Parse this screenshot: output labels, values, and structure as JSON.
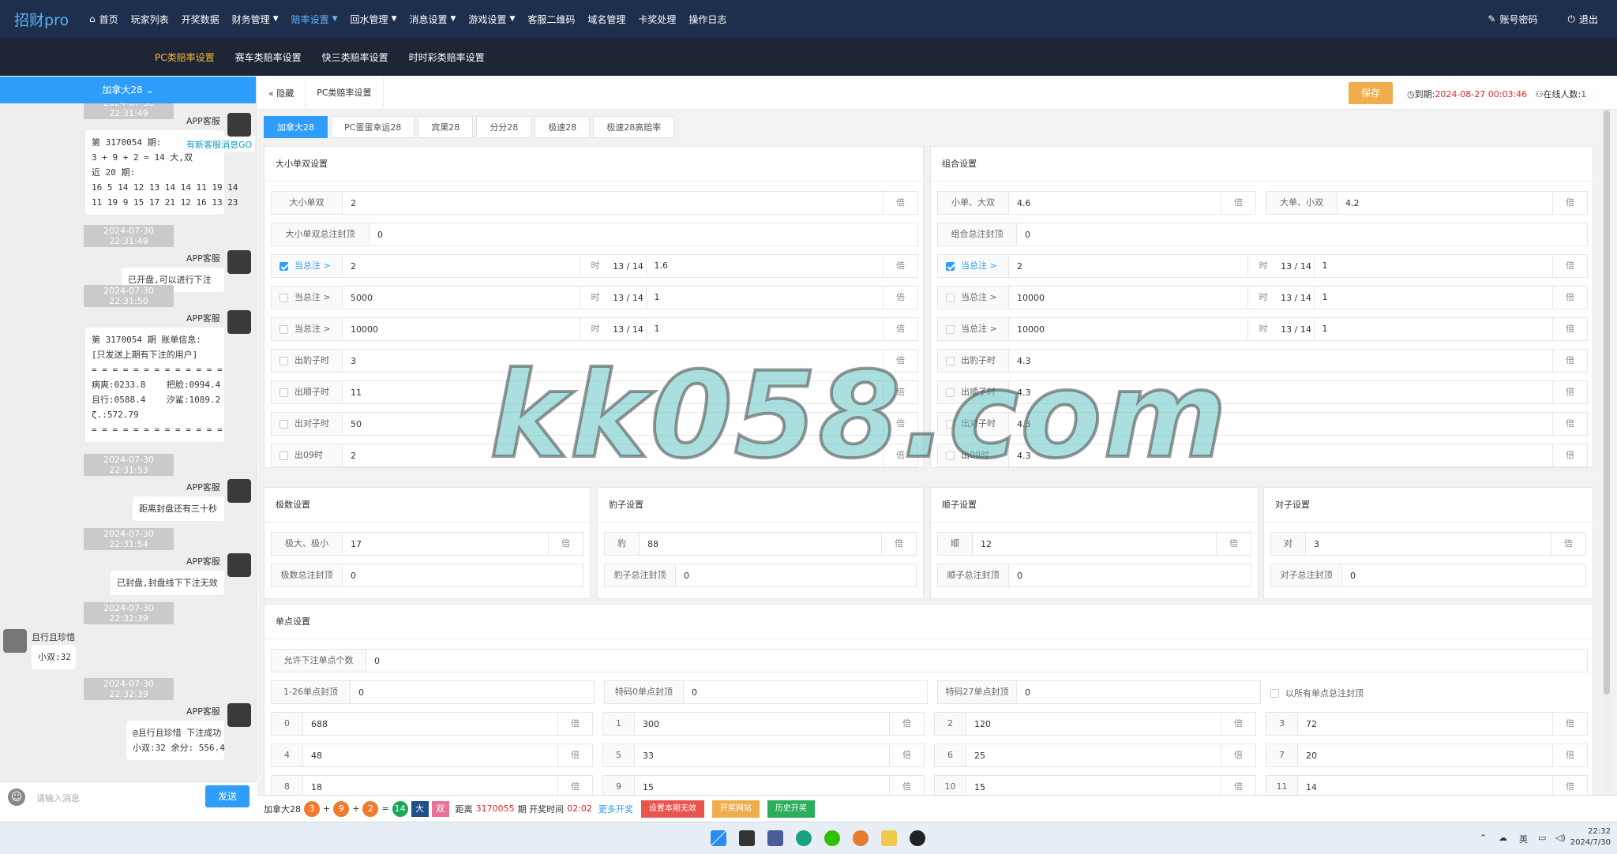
{
  "nav": {
    "logo": "招财pro",
    "home": "首页",
    "items": [
      {
        "label": "玩家列表",
        "dropdown": false
      },
      {
        "label": "开奖数据",
        "dropdown": false
      },
      {
        "label": "财务管理",
        "dropdown": true
      },
      {
        "label": "赔率设置",
        "dropdown": true,
        "active": true
      },
      {
        "label": "回水管理",
        "dropdown": true
      },
      {
        "label": "消息设置",
        "dropdown": true
      },
      {
        "label": "游戏设置",
        "dropdown": true
      },
      {
        "label": "客服二维码",
        "dropdown": false
      },
      {
        "label": "域名管理",
        "dropdown": false
      },
      {
        "label": "卡奖处理",
        "dropdown": false
      },
      {
        "label": "操作日志",
        "dropdown": false
      }
    ],
    "account": "账号密码",
    "logout": "退出"
  },
  "subnav": [
    "PC类赔率设置",
    "赛车类赔率设置",
    "快三类赔率设置",
    "时时彩类赔率设置"
  ],
  "chat": {
    "header": "加拿大28",
    "new_msg": "有新客服消息GO",
    "input_placeholder": "请输入消息",
    "send": "发送",
    "top_ts": "2024-07-30 22:31:49",
    "messages": [
      {
        "ts": "",
        "sender": "APP客服",
        "text": "第 3170054 期:\n3 + 9 + 2 = 14 大,双\n近 20 期:\n16 5 14 12 13 14 14 11 19 14\n11 19 9 15 17 21 12 16 13 23"
      },
      {
        "ts": "2024-07-30 22:31:49",
        "sender": "APP客服",
        "text": "已开盘,可以进行下注"
      },
      {
        "ts": "2024-07-30 22:31:50",
        "sender": "APP客服",
        "text": "第 3170054 期 账单信息:\n[只发送上期有下注的用户]\n= = = = = = = = = = = = =\n病爽:0233.8    把脸:0994.4\n且行:0588.4    汐鲨:1089.2\nζ.:572.79\n= = = = = = = = = = = = ="
      },
      {
        "ts": "2024-07-30 22:31:53",
        "sender": "APP客服",
        "text": "距离封盘还有三十秒"
      },
      {
        "ts": "2024-07-30 22:31:54",
        "sender": "APP客服",
        "text": "已封盘,封盘线下下注无效"
      },
      {
        "ts": "2024-07-30 22:32:39",
        "sender": "且行且珍惜",
        "text": "小双:32"
      },
      {
        "ts": "2024-07-30 22:32:39",
        "sender": "APP客服",
        "text": "@且行且珍惜 下注成功\n小双:32 余分: 556.4"
      }
    ]
  },
  "toolbar": {
    "hide": "隐藏",
    "tab": "PC类赔率设置",
    "save": "保存",
    "expire_label": "到期:",
    "expire_value": "2024-08-27 00:03:46",
    "online_label": "在线人数:",
    "online_value": "1"
  },
  "game_tabs": [
    "加拿大28",
    "PC蛋蛋幸运28",
    "宾果28",
    "分分28",
    "极速28",
    "极速28高赔率"
  ],
  "common": {
    "unit": "倍",
    "when": "时",
    "ratio": "13 / 14"
  },
  "dxds": {
    "title": "大小单双设置",
    "odds_label": "大小单双",
    "odds": "2",
    "cap_label": "大小单双总注封顶",
    "cap": "0",
    "thresholds": [
      {
        "checked": true,
        "label": "当总注 >",
        "amount": "2",
        "rate": "1.6"
      },
      {
        "checked": false,
        "label": "当总注 >",
        "amount": "5000",
        "rate": "1"
      },
      {
        "checked": false,
        "label": "当总注 >",
        "amount": "10000",
        "rate": "1"
      }
    ],
    "specials": [
      {
        "label": "出豹子时",
        "value": "3"
      },
      {
        "label": "出顺子时",
        "value": "11"
      },
      {
        "label": "出对子时",
        "value": "50"
      },
      {
        "label": "出09时",
        "value": "2"
      }
    ]
  },
  "combo": {
    "title": "组合设置",
    "a_label": "小单、大双",
    "a": "4.6",
    "b_label": "大单、小双",
    "b": "4.2",
    "cap_label": "组合总注封顶",
    "cap": "0",
    "thresholds": [
      {
        "checked": true,
        "label": "当总注 >",
        "amount": "2",
        "rate": "1"
      },
      {
        "checked": false,
        "label": "当总注 >",
        "amount": "10000",
        "rate": "1"
      },
      {
        "checked": false,
        "label": "当总注 >",
        "amount": "10000",
        "rate": "1"
      }
    ],
    "specials": [
      {
        "label": "出豹子时",
        "value": "4.3"
      },
      {
        "label": "出顺子时",
        "value": "4.3"
      },
      {
        "label": "出对子时",
        "value": "4.3"
      },
      {
        "label": "出09时",
        "value": "4.3"
      }
    ]
  },
  "jishu": {
    "title": "极数设置",
    "label": "极大、极小",
    "value": "17",
    "cap_label": "极数总注封顶",
    "cap": "0"
  },
  "baozi": {
    "title": "豹子设置",
    "label": "豹",
    "value": "88",
    "cap_label": "豹子总注封顶",
    "cap": "0"
  },
  "shunzi": {
    "title": "顺子设置",
    "label": "顺",
    "value": "12",
    "cap_label": "顺子总注封顶",
    "cap": "0"
  },
  "duizi": {
    "title": "对子设置",
    "label": "对",
    "value": "3",
    "cap_label": "对子总注封顶",
    "cap": "0"
  },
  "danian": {
    "title": "单点设置",
    "allow_label": "允许下注单点个数",
    "allow": "0",
    "caps": [
      {
        "label": "1-26单点封顶",
        "value": "0"
      },
      {
        "label": "特码0单点封顶",
        "value": "0"
      },
      {
        "label": "特码27单点封顶",
        "value": "0"
      }
    ],
    "all_cap": "以所有单点总注封顶",
    "points": [
      {
        "n": "0",
        "v": "688"
      },
      {
        "n": "1",
        "v": "300"
      },
      {
        "n": "2",
        "v": "120"
      },
      {
        "n": "3",
        "v": "72"
      },
      {
        "n": "4",
        "v": "48"
      },
      {
        "n": "5",
        "v": "33"
      },
      {
        "n": "6",
        "v": "25"
      },
      {
        "n": "7",
        "v": "20"
      },
      {
        "n": "8",
        "v": "18"
      },
      {
        "n": "9",
        "v": "15"
      },
      {
        "n": "10",
        "v": "15"
      },
      {
        "n": "11",
        "v": "14"
      }
    ]
  },
  "status": {
    "game": "加拿大28",
    "balls": [
      "3",
      "9",
      "2"
    ],
    "sum": "14",
    "big": "大",
    "even": "双",
    "dist": "距离",
    "issue": "3170055",
    "open_text": "期 开奖时间",
    "countdown": "02:02",
    "more": "更多开奖",
    "btn1": "设置本期无效",
    "btn2": "开奖网站",
    "btn3": "历史开奖"
  },
  "taskbar": {
    "lang": "英",
    "time": "22:32",
    "date": "2024/7/30"
  },
  "watermark": "kk058.com"
}
